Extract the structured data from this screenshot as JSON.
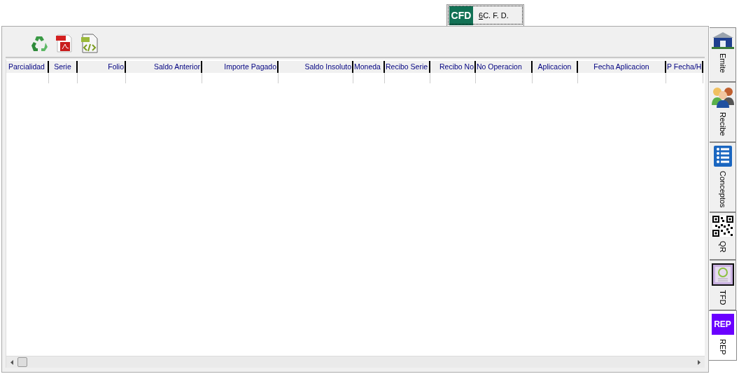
{
  "top_tab": {
    "logo": "CFD",
    "label": "6C. F. D.",
    "selected": true
  },
  "toolbar": {
    "buttons": [
      {
        "kind": "recycle"
      },
      {
        "kind": "pdf"
      },
      {
        "kind": "xml"
      }
    ]
  },
  "table": {
    "columns": [
      {
        "label": "Parcialidad"
      },
      {
        "label": "Serie"
      },
      {
        "label": "Folio"
      },
      {
        "label": "Saldo Anterior"
      },
      {
        "label": "Importe Pagado"
      },
      {
        "label": "Saldo Insoluto"
      },
      {
        "label": "Moneda"
      },
      {
        "label": "Recibo Serie"
      },
      {
        "label": "Recibo No"
      },
      {
        "label": "No Operacion"
      },
      {
        "label": "Aplicacion"
      },
      {
        "label": "Fecha Aplicacion"
      },
      {
        "label": "P Fecha/H"
      }
    ]
  },
  "side_tabs": [
    {
      "kind": "building",
      "label": "Emite",
      "selected": false
    },
    {
      "kind": "people",
      "label": "Recibe",
      "selected": false
    },
    {
      "kind": "list",
      "label": "Conceptos",
      "selected": false
    },
    {
      "kind": "qr",
      "label": "QR",
      "selected": false
    },
    {
      "kind": "stamp",
      "label": "TFD",
      "selected": false
    },
    {
      "kind": "rep",
      "logo": "REP",
      "label": "REP",
      "selected": true
    }
  ]
}
